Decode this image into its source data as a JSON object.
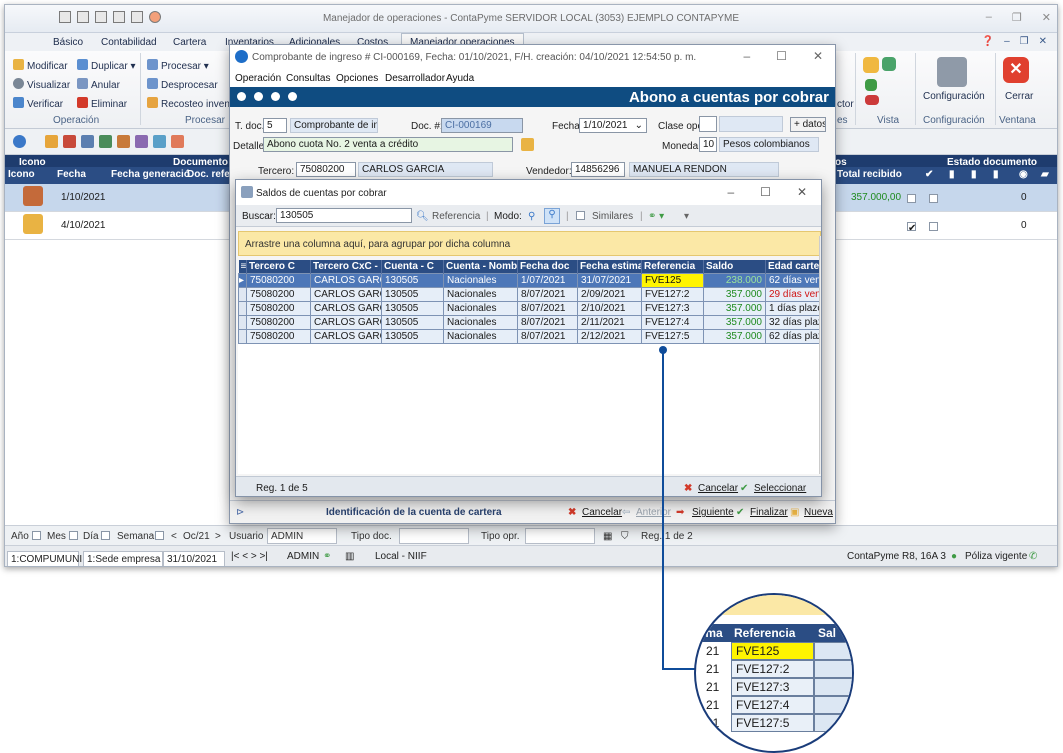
{
  "app": {
    "title": "Manejador de operaciones - ContaPyme SERVIDOR LOCAL (3053) EJEMPLO CONTAPYME",
    "ribbon_tabs": [
      "Básico",
      "Contabilidad",
      "Cartera",
      "Inventarios",
      "Adicionales",
      "Costos",
      "Manejador operaciones"
    ],
    "ribbon": {
      "modificar": "Modificar",
      "duplicar": "Duplicar",
      "visualizar": "Visualizar",
      "anular": "Anular",
      "verificar": "Verificar",
      "eliminar": "Eliminar",
      "procesar": "Procesar",
      "desprocesar": "Desprocesar",
      "recosteo": "Recosteo inventa",
      "group_operacion": "Operación",
      "group_procesar": "Procesar",
      "ctor": "ctor",
      "configuracion": "Configuración",
      "cerrar": "Cerrar",
      "group_es": "es",
      "group_vista": "Vista",
      "group_configuracion": "Configuración",
      "group_ventana": "Ventana"
    },
    "grid": {
      "hdr_icono": "Icono",
      "hdr_documento": "Documento",
      "hdr_os": "os",
      "hdr_estado": "Estado documento",
      "col_icono": "Icono",
      "col_fecha": "Fecha",
      "col_fecha_gen": "Fecha generació",
      "col_doc_ref": "Doc. refe",
      "col_total": "Total recibido",
      "rows": [
        {
          "fecha": "1/10/2021",
          "total": "357.000,00",
          "estado": "0"
        },
        {
          "fecha": "4/10/2021",
          "total": "",
          "estado": "0"
        }
      ]
    },
    "filters": {
      "ano": "Año",
      "mes": "Mes",
      "dia": "Día",
      "semana": "Semana",
      "periodo": "Oc/21",
      "usuario": "Usuario",
      "usuario_val": "ADMIN",
      "tipo_doc": "Tipo doc.",
      "tipo_opr": "Tipo opr.",
      "reg": "Reg. 1 de 2"
    },
    "status": {
      "equipo": "1:COMPUMUNI",
      "empresa": "1:Sede empresa",
      "fecha": "31/10/2021",
      "nav": "|<  <  >  >|",
      "usuario": "ADMIN",
      "contexto": "Local - NIIF",
      "version": "ContaPyme R8, 16A 3",
      "poliza": "Póliza vigente"
    }
  },
  "comprobante": {
    "title": "Comprobante de ingreso # CI-000169, Fecha: 01/10/2021, F/H. creación: 04/10/2021 12:54:50 p. m.",
    "menu": [
      "Operación",
      "Consultas",
      "Opciones",
      "Desarrollador",
      "Ayuda"
    ],
    "banner": "Abono a cuentas por cobrar",
    "fields": {
      "tdoc_label": "T. doc.:",
      "tdoc": "5",
      "tdoc_name": "Comprobante de ingre",
      "docnum_label": "Doc. #:",
      "docnum": "CI-000169",
      "fecha_label": "Fecha:",
      "fecha": "1/10/2021",
      "clase_label": "Clase oper.",
      "datos": "+ datos",
      "detalle_label": "Detalle:",
      "detalle": "Abono cuota No. 2 venta a crédito",
      "moneda_label": "Moneda:",
      "moneda": "10",
      "moneda_name": "Pesos colombianos",
      "tercero_label": "Tercero:",
      "tercero": "75080200",
      "tercero_name": "CARLOS GARCIA",
      "vendedor_label": "Vendedor:",
      "vendedor": "14856296",
      "vendedor_name": "MANUELA RENDON"
    },
    "bottom": {
      "ident": "Identificación de la cuenta de cartera",
      "cancelar": "Cancelar",
      "anterior": "Anterior",
      "siguiente": "Siguiente",
      "finalizar": "Finalizar",
      "nueva": "Nueva"
    }
  },
  "saldos": {
    "title": "Saldos de cuentas por cobrar",
    "buscar_label": "Buscar:",
    "buscar_value": "130505",
    "referencia": "Referencia",
    "modo": "Modo:",
    "similares": "Similares",
    "group_hint": "Arrastre una columna aquí, para agrupar por dicha columna",
    "columns": [
      "Tercero C",
      "Tercero CxC - N",
      "Cuenta - C",
      "Cuenta - Nombr",
      "Fecha doc",
      "Fecha estima",
      "Referencia",
      "Saldo",
      "Edad carte"
    ],
    "rows": [
      {
        "tercero": "75080200",
        "nombre": "CARLOS GARCIA",
        "cuenta": "130505",
        "cuenta_nombre": "Nacionales",
        "fecha_doc": "1/07/2021",
        "fecha_est": "31/07/2021",
        "referencia": "FVE125",
        "saldo": "238.000",
        "edad": "62 días venc"
      },
      {
        "tercero": "75080200",
        "nombre": "CARLOS GARCIA",
        "cuenta": "130505",
        "cuenta_nombre": "Nacionales",
        "fecha_doc": "8/07/2021",
        "fecha_est": "2/09/2021",
        "referencia": "FVE127:2",
        "saldo": "357.000",
        "edad": "29 días venc"
      },
      {
        "tercero": "75080200",
        "nombre": "CARLOS GARCIA",
        "cuenta": "130505",
        "cuenta_nombre": "Nacionales",
        "fecha_doc": "8/07/2021",
        "fecha_est": "2/10/2021",
        "referencia": "FVE127:3",
        "saldo": "357.000",
        "edad": "1 días plazo"
      },
      {
        "tercero": "75080200",
        "nombre": "CARLOS GARCIA",
        "cuenta": "130505",
        "cuenta_nombre": "Nacionales",
        "fecha_doc": "8/07/2021",
        "fecha_est": "2/11/2021",
        "referencia": "FVE127:4",
        "saldo": "357.000",
        "edad": "32 días plazo"
      },
      {
        "tercero": "75080200",
        "nombre": "CARLOS GARCIA",
        "cuenta": "130505",
        "cuenta_nombre": "Nacionales",
        "fecha_doc": "8/07/2021",
        "fecha_est": "2/12/2021",
        "referencia": "FVE127:5",
        "saldo": "357.000",
        "edad": "62 días plazo"
      }
    ],
    "reg": "Reg. 1 de 5",
    "cancelar": "Cancelar",
    "seleccionar": "Seleccionar"
  },
  "zoom": {
    "col_left": "ima",
    "col_ref": "Referencia",
    "col_right": "Sal",
    "rows": [
      {
        "left": "21",
        "ref": "FVE125"
      },
      {
        "left": "21",
        "ref": "FVE127:2"
      },
      {
        "left": "21",
        "ref": "FVE127:3"
      },
      {
        "left": "21",
        "ref": "FVE127:4"
      },
      {
        "left": "21",
        "ref": "FVE127:5"
      }
    ]
  },
  "colors": {
    "header_blue": "#2b4d84",
    "banner_blue": "#0f4c81",
    "highlight_yellow": "#fff400",
    "hint_yellow": "#fbe8a6",
    "selected_row": "#4d77b8"
  }
}
